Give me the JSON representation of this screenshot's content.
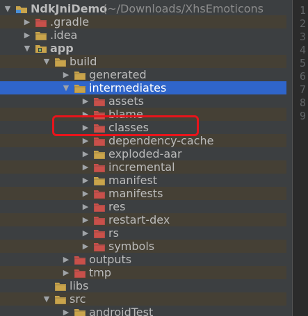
{
  "project": {
    "name": "NdkJniDemo",
    "path": "(~/Downloads/XhsEmoticons"
  },
  "tree": [
    {
      "label": "NdkJniDemo",
      "hint": " (~/Downloads/XhsEmoticons",
      "depth": 0,
      "arrow": "down",
      "icon": "project"
    },
    {
      "label": ".gradle",
      "depth": 1,
      "arrow": "right",
      "icon": "folder-red"
    },
    {
      "label": ".idea",
      "depth": 1,
      "arrow": "right",
      "icon": "folder"
    },
    {
      "label": "app",
      "depth": 1,
      "arrow": "down",
      "icon": "module",
      "bold": true
    },
    {
      "label": "build",
      "depth": 2,
      "arrow": "down",
      "icon": "folder"
    },
    {
      "label": "generated",
      "depth": 3,
      "arrow": "right",
      "icon": "folder"
    },
    {
      "label": "intermediates",
      "depth": 3,
      "arrow": "down",
      "icon": "folder",
      "selected": true
    },
    {
      "label": "assets",
      "depth": 4,
      "arrow": "right",
      "icon": "folder-red"
    },
    {
      "label": "blame",
      "depth": 4,
      "arrow": "right",
      "icon": "folder-red"
    },
    {
      "label": "classes",
      "depth": 4,
      "arrow": "right",
      "icon": "folder-red"
    },
    {
      "label": "dependency-cache",
      "depth": 4,
      "arrow": "right",
      "icon": "folder-red"
    },
    {
      "label": "exploded-aar",
      "depth": 4,
      "arrow": "right",
      "icon": "folder"
    },
    {
      "label": "incremental",
      "depth": 4,
      "arrow": "right",
      "icon": "folder-red"
    },
    {
      "label": "manifest",
      "depth": 4,
      "arrow": "right",
      "icon": "folder"
    },
    {
      "label": "manifests",
      "depth": 4,
      "arrow": "right",
      "icon": "folder-red"
    },
    {
      "label": "res",
      "depth": 4,
      "arrow": "right",
      "icon": "folder-red"
    },
    {
      "label": "restart-dex",
      "depth": 4,
      "arrow": "right",
      "icon": "folder-red"
    },
    {
      "label": "rs",
      "depth": 4,
      "arrow": "right",
      "icon": "folder-red"
    },
    {
      "label": "symbols",
      "depth": 4,
      "arrow": "right",
      "icon": "folder-red"
    },
    {
      "label": "outputs",
      "depth": 3,
      "arrow": "right",
      "icon": "folder-red"
    },
    {
      "label": "tmp",
      "depth": 3,
      "arrow": "right",
      "icon": "folder-red"
    },
    {
      "label": "libs",
      "depth": 2,
      "arrow": "none",
      "icon": "folder"
    },
    {
      "label": "src",
      "depth": 2,
      "arrow": "down",
      "icon": "folder"
    },
    {
      "label": "androidTest",
      "depth": 3,
      "arrow": "right",
      "icon": "folder"
    }
  ],
  "line_numbers": [
    "1",
    "2",
    "3",
    "4",
    "5",
    "6",
    "7",
    "8",
    "9"
  ],
  "colors": {
    "background": "#3c3f41",
    "selection": "#2f65ca",
    "highlight_box": "#e8141b",
    "folder": "#c9a44b",
    "folder_excluded": "#c9504a"
  }
}
